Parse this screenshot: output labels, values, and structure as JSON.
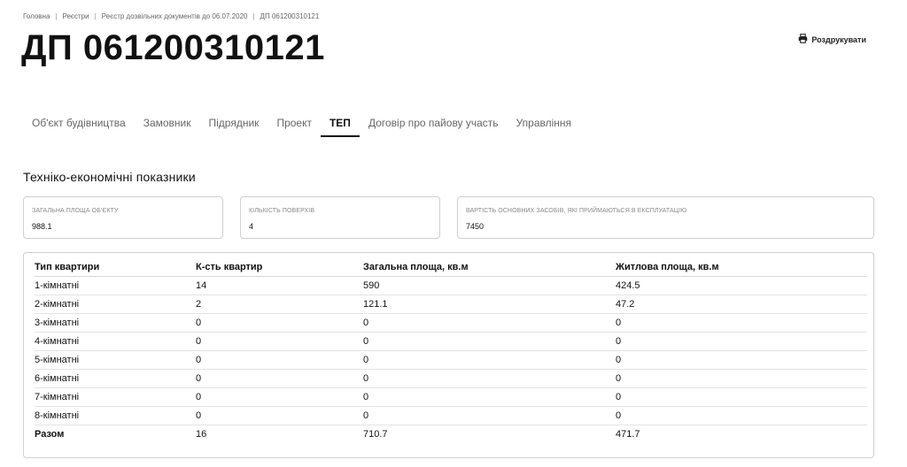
{
  "breadcrumb": [
    "Головна",
    "Реєстри",
    "Реєстр дозвільних документів до 06.07.2020",
    "ДП 061200310121"
  ],
  "title": "ДП 061200310121",
  "print_label": "Роздрукувати",
  "tabs": [
    {
      "label": "Об'єкт будівництва",
      "active": false
    },
    {
      "label": "Замовник",
      "active": false
    },
    {
      "label": "Підрядник",
      "active": false
    },
    {
      "label": "Проект",
      "active": false
    },
    {
      "label": "ТЕП",
      "active": true
    },
    {
      "label": "Договір про пайову участь",
      "active": false
    },
    {
      "label": "Управління",
      "active": false
    }
  ],
  "section_title": "Техніко-економічні показники",
  "cards": [
    {
      "label": "Загальна площа об'єкту",
      "value": "988.1"
    },
    {
      "label": "Кількість поверхів",
      "value": "4"
    },
    {
      "label": "Вартість основних засобів, які приймаються в експлуатацію",
      "value": "7450"
    }
  ],
  "table": {
    "headers": [
      "Тип квартири",
      "К-сть квартир",
      "Загальна площа, кв.м",
      "Житлова площа, кв.м"
    ],
    "rows": [
      [
        "1-кімнатні",
        "14",
        "590",
        "424.5"
      ],
      [
        "2-кімнатні",
        "2",
        "121.1",
        "47.2"
      ],
      [
        "3-кімнатні",
        "0",
        "0",
        "0"
      ],
      [
        "4-кімнатні",
        "0",
        "0",
        "0"
      ],
      [
        "5-кімнатні",
        "0",
        "0",
        "0"
      ],
      [
        "6-кімнатні",
        "0",
        "0",
        "0"
      ],
      [
        "7-кімнатні",
        "0",
        "0",
        "0"
      ],
      [
        "8-кімнатні",
        "0",
        "0",
        "0"
      ]
    ],
    "total": [
      "Разом",
      "16",
      "710.7",
      "471.7"
    ]
  },
  "icons": {
    "print": "printer-icon"
  }
}
